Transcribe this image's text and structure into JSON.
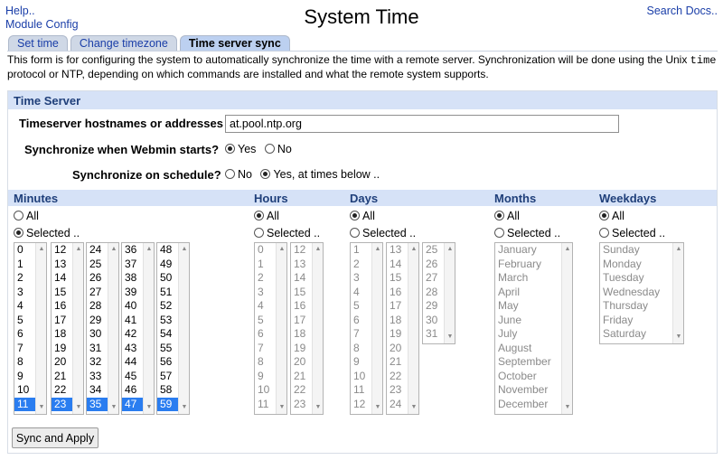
{
  "top_links": {
    "help": "Help..",
    "module_config": "Module Config",
    "search": "Search Docs.."
  },
  "title": "System Time",
  "tabs": [
    {
      "label": "Set time",
      "active": false
    },
    {
      "label": "Change timezone",
      "active": false
    },
    {
      "label": "Time server sync",
      "active": true
    }
  ],
  "intro": {
    "part1": "This form is for configuring the system to automatically synchronize the time with a remote server. Synchronization will be done using the Unix ",
    "code": "time",
    "part2": " protocol or NTP, depending on which commands are installed and what the remote system supports."
  },
  "section_title": "Time Server",
  "hostnames": {
    "label": "Timeserver hostnames or addresses",
    "value": "at.pool.ntp.org"
  },
  "sync_start": {
    "label": "Synchronize when Webmin starts?",
    "options": [
      "Yes",
      "No"
    ],
    "selected": "Yes"
  },
  "sync_schedule": {
    "label": "Synchronize on schedule?",
    "options": [
      "No",
      "Yes, at times below .."
    ],
    "selected": "Yes, at times below .."
  },
  "schedule": {
    "all_label": "All",
    "selected_label": "Selected ..",
    "columns": [
      {
        "name": "Minutes",
        "mode": "Selected .."
      },
      {
        "name": "Hours",
        "mode": "All"
      },
      {
        "name": "Days",
        "mode": "All"
      },
      {
        "name": "Months",
        "mode": "All"
      },
      {
        "name": "Weekdays",
        "mode": "All"
      }
    ],
    "minutes_lists": [
      [
        "0",
        "1",
        "2",
        "3",
        "4",
        "5",
        "6",
        "7",
        "8",
        "9",
        "10",
        "11"
      ],
      [
        "12",
        "13",
        "14",
        "15",
        "16",
        "17",
        "18",
        "19",
        "20",
        "21",
        "22",
        "23"
      ],
      [
        "24",
        "25",
        "26",
        "27",
        "28",
        "29",
        "30",
        "31",
        "32",
        "33",
        "34",
        "35"
      ],
      [
        "36",
        "37",
        "38",
        "39",
        "40",
        "41",
        "42",
        "43",
        "44",
        "45",
        "46",
        "47"
      ],
      [
        "48",
        "49",
        "50",
        "51",
        "52",
        "53",
        "54",
        "55",
        "56",
        "57",
        "58",
        "59"
      ]
    ],
    "minutes_selected": [
      "11",
      "23",
      "35",
      "47",
      "59"
    ],
    "hours_lists": [
      [
        "0",
        "1",
        "2",
        "3",
        "4",
        "5",
        "6",
        "7",
        "8",
        "9",
        "10",
        "11"
      ],
      [
        "12",
        "13",
        "14",
        "15",
        "16",
        "17",
        "18",
        "19",
        "20",
        "21",
        "22",
        "23"
      ]
    ],
    "days_lists": [
      [
        "1",
        "2",
        "3",
        "4",
        "5",
        "6",
        "7",
        "8",
        "9",
        "10",
        "11",
        "12"
      ],
      [
        "13",
        "14",
        "15",
        "16",
        "17",
        "18",
        "19",
        "20",
        "21",
        "22",
        "23",
        "24"
      ],
      [
        "25",
        "26",
        "27",
        "28",
        "29",
        "30",
        "31"
      ]
    ],
    "months": [
      "January",
      "February",
      "March",
      "April",
      "May",
      "June",
      "July",
      "August",
      "September",
      "October",
      "November",
      "December"
    ],
    "weekdays": [
      "Sunday",
      "Monday",
      "Tuesday",
      "Wednesday",
      "Thursday",
      "Friday",
      "Saturday"
    ]
  },
  "button": "Sync and Apply",
  "colors": {
    "accent": "#2a7df0",
    "header_bg": "#d6e2f7",
    "link": "#1a3ea8"
  }
}
